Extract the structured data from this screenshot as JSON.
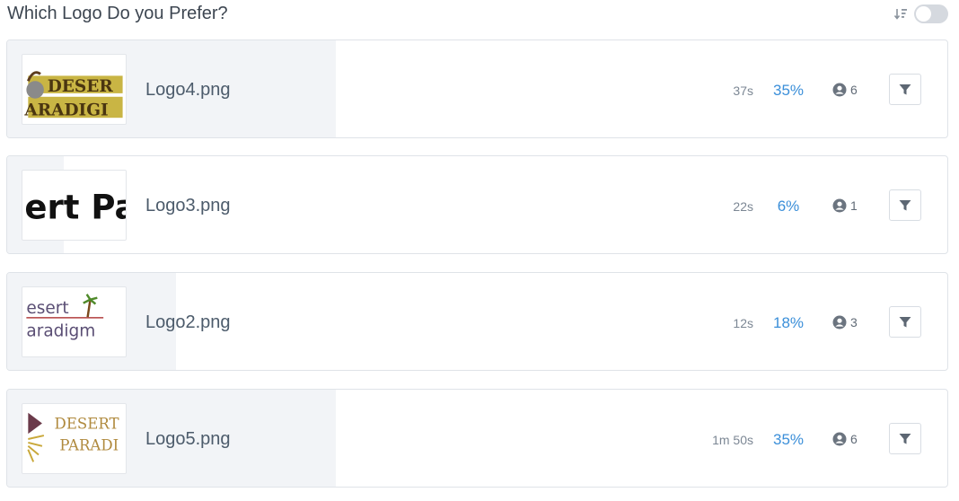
{
  "header": {
    "title": "Which Logo Do you Prefer?"
  },
  "rows": [
    {
      "file": "Logo4.png",
      "time": "37s",
      "percent": "35%",
      "fraction": 0.35,
      "users": "6",
      "thumb": {
        "line1": "DESER",
        "line2": "ARADIGI"
      }
    },
    {
      "file": "Logo3.png",
      "time": "22s",
      "percent": "6%",
      "fraction": 0.06,
      "users": "1",
      "thumb": {
        "line1": "ert Pa"
      }
    },
    {
      "file": "Logo2.png",
      "time": "12s",
      "percent": "18%",
      "fraction": 0.18,
      "users": "3",
      "thumb": {
        "line1": "esert",
        "line2": "aradigm"
      }
    },
    {
      "file": "Logo5.png",
      "time": "1m 50s",
      "percent": "35%",
      "fraction": 0.35,
      "users": "6",
      "thumb": {
        "line1": "DESERT",
        "line2": "PARADI"
      }
    }
  ],
  "icons": {
    "sort": "sort-amount-down-icon",
    "user": "user-circle-icon",
    "filter": "filter-icon"
  },
  "colors": {
    "percent": "#3b8fd9",
    "fill": "#f2f4f7"
  }
}
